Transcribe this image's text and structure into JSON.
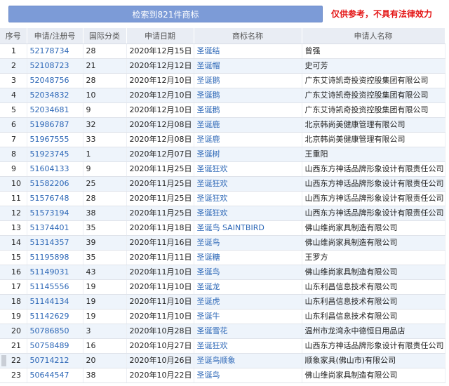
{
  "header": {
    "banner_label": "检索到821件商标",
    "disclaimer": "仅供参考，不具有法律效力"
  },
  "table": {
    "columns": [
      "序号",
      "申请/注册号",
      "国际分类",
      "申请日期",
      "商标名称",
      "申请人名称"
    ],
    "rows": [
      {
        "idx": "1",
        "reg": "52178734",
        "cls": "28",
        "date": "2020年12月15日",
        "tm": "圣诞结",
        "applicant": "曾强"
      },
      {
        "idx": "2",
        "reg": "52108723",
        "cls": "21",
        "date": "2020年12月12日",
        "tm": "圣诞帽",
        "applicant": "史可芳"
      },
      {
        "idx": "3",
        "reg": "52048756",
        "cls": "28",
        "date": "2020年12月10日",
        "tm": "圣诞鹅",
        "applicant": "广东艾诗凯奇投资控股集团有限公司"
      },
      {
        "idx": "4",
        "reg": "52034832",
        "cls": "10",
        "date": "2020年12月10日",
        "tm": "圣诞鹅",
        "applicant": "广东艾诗凯奇投资控股集团有限公司"
      },
      {
        "idx": "5",
        "reg": "52034681",
        "cls": "9",
        "date": "2020年12月10日",
        "tm": "圣诞鹅",
        "applicant": "广东艾诗凯奇投资控股集团有限公司"
      },
      {
        "idx": "6",
        "reg": "51986787",
        "cls": "32",
        "date": "2020年12月08日",
        "tm": "圣诞鹿",
        "applicant": "北京韩尚美健康管理有限公司"
      },
      {
        "idx": "7",
        "reg": "51967555",
        "cls": "33",
        "date": "2020年12月08日",
        "tm": "圣诞鹿",
        "applicant": "北京韩尚美健康管理有限公司"
      },
      {
        "idx": "8",
        "reg": "51923745",
        "cls": "1",
        "date": "2020年12月07日",
        "tm": "圣诞树",
        "applicant": "王重阳"
      },
      {
        "idx": "9",
        "reg": "51604133",
        "cls": "9",
        "date": "2020年11月25日",
        "tm": "圣诞狂欢",
        "applicant": "山西东方神话品牌形象设计有限责任公司"
      },
      {
        "idx": "10",
        "reg": "51582206",
        "cls": "25",
        "date": "2020年11月25日",
        "tm": "圣诞狂欢",
        "applicant": "山西东方神话品牌形象设计有限责任公司"
      },
      {
        "idx": "11",
        "reg": "51576748",
        "cls": "28",
        "date": "2020年11月25日",
        "tm": "圣诞狂欢",
        "applicant": "山西东方神话品牌形象设计有限责任公司"
      },
      {
        "idx": "12",
        "reg": "51573194",
        "cls": "38",
        "date": "2020年11月25日",
        "tm": "圣诞狂欢",
        "applicant": "山西东方神话品牌形象设计有限责任公司"
      },
      {
        "idx": "13",
        "reg": "51374401",
        "cls": "35",
        "date": "2020年11月18日",
        "tm": "圣诞鸟 SAINTBIRD",
        "applicant": "佛山维尚家具制造有限公司"
      },
      {
        "idx": "14",
        "reg": "51314357",
        "cls": "39",
        "date": "2020年11月16日",
        "tm": "圣诞鸟",
        "applicant": "佛山维尚家具制造有限公司"
      },
      {
        "idx": "15",
        "reg": "51195898",
        "cls": "35",
        "date": "2020年11月11日",
        "tm": "圣诞糖",
        "applicant": "王罗方"
      },
      {
        "idx": "16",
        "reg": "51149031",
        "cls": "43",
        "date": "2020年11月10日",
        "tm": "圣诞鸟",
        "applicant": "佛山维尚家具制造有限公司"
      },
      {
        "idx": "17",
        "reg": "51145556",
        "cls": "19",
        "date": "2020年11月10日",
        "tm": "圣诞龙",
        "applicant": "山东利昌信息技术有限公司"
      },
      {
        "idx": "18",
        "reg": "51144134",
        "cls": "19",
        "date": "2020年11月10日",
        "tm": "圣诞虎",
        "applicant": "山东利昌信息技术有限公司"
      },
      {
        "idx": "19",
        "reg": "51142629",
        "cls": "19",
        "date": "2020年11月10日",
        "tm": "圣诞牛",
        "applicant": "山东利昌信息技术有限公司"
      },
      {
        "idx": "20",
        "reg": "50786850",
        "cls": "3",
        "date": "2020年10月28日",
        "tm": "圣诞雪花",
        "applicant": "温州市龙湾永中德恒日用品店"
      },
      {
        "idx": "21",
        "reg": "50758489",
        "cls": "16",
        "date": "2020年10月27日",
        "tm": "圣诞狂欢",
        "applicant": "山西东方神话品牌形象设计有限责任公司"
      },
      {
        "idx": "22",
        "reg": "50714212",
        "cls": "20",
        "date": "2020年10月26日",
        "tm": "圣诞鸟顺象",
        "applicant": "顺象家具(佛山市)有限公司"
      },
      {
        "idx": "23",
        "reg": "50644547",
        "cls": "38",
        "date": "2020年10月22日",
        "tm": "圣诞鸟",
        "applicant": "佛山维尚家具制造有限公司"
      }
    ]
  }
}
